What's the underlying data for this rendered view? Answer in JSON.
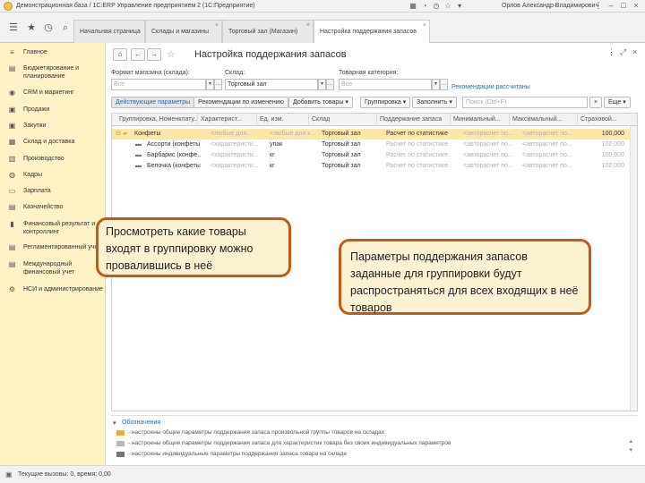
{
  "window": {
    "title": "Демонстрационная база / 1С:ERP Управление предприятием 2  (1С:Предприятие)",
    "user": "Орлов Александр Владимирович"
  },
  "tabs": [
    {
      "label": "Начальная страница"
    },
    {
      "label": "Склады и магазины"
    },
    {
      "label": "Торговый зал (Магазин)"
    },
    {
      "label": "Настройка поддержания запасов"
    }
  ],
  "sidebar": {
    "items": [
      {
        "label": "Главное",
        "icon": "menu-icon"
      },
      {
        "label": "Бюджетирование и планирование",
        "icon": "budget-icon"
      },
      {
        "label": "CRM и маркетинг",
        "icon": "crm-icon"
      },
      {
        "label": "Продажи",
        "icon": "sales-icon"
      },
      {
        "label": "Закупки",
        "icon": "purchases-icon"
      },
      {
        "label": "Склад и доставка",
        "icon": "warehouse-icon"
      },
      {
        "label": "Производство",
        "icon": "production-icon"
      },
      {
        "label": "Кадры",
        "icon": "staff-icon"
      },
      {
        "label": "Зарплата",
        "icon": "salary-icon"
      },
      {
        "label": "Казначейство",
        "icon": "treasury-icon"
      },
      {
        "label": "Финансовый результат и контроллинг",
        "icon": "finance-icon"
      },
      {
        "label": "Регламентированный учет",
        "icon": "accounting-icon"
      },
      {
        "label": "Международный финансовый учет",
        "icon": "intl-finance-icon"
      },
      {
        "label": "НСИ и администрирование",
        "icon": "admin-icon"
      }
    ]
  },
  "form": {
    "title": "Настройка поддержания запасов",
    "filters": {
      "store_format_label": "Формат магазина (склада):",
      "store_format_value": "Все",
      "warehouse_label": "Склад:",
      "warehouse_value": "Торговый зал",
      "category_label": "Товарная категория:",
      "category_value": "Все"
    },
    "recommendations_link": "Рекомендации рассчитаны",
    "toolbar": {
      "active_params": "Действующие параметры",
      "recommend_changes": "Рекомендации по изменению",
      "add_goods": "Добавить товары",
      "grouping": "Группировка",
      "fill": "Заполнить",
      "search_placeholder": "Поиск (Ctrl+F)",
      "more": "Еще"
    }
  },
  "table": {
    "columns": [
      "Группировка, Номенклату...",
      "Характерист...",
      "Ед. изм.",
      "Склад",
      "Поддержание запаса",
      "Минимальный...",
      "Максимальный...",
      "Страховой..."
    ],
    "rows": [
      {
        "name": "Конфеты",
        "char": "<любые для...",
        "unit": "<любые для к...",
        "warehouse": "Торговый зал",
        "method": "Расчет по статистике",
        "min": "<авторасчет по...",
        "max": "<авторасчет по...",
        "safety": "100,000"
      },
      {
        "name": "Ассорти (конфеты)",
        "char": "<характеристи...",
        "unit": "упак",
        "warehouse": "Торговый зал",
        "method": "Расчет по статистике",
        "min": "<авторасчет по...",
        "max": "<авторасчет по...",
        "safety": "100,000"
      },
      {
        "name": "Барбарис (конфе...",
        "char": "<характеристи...",
        "unit": "кг",
        "warehouse": "Торговый зал",
        "method": "Расчет по статистике",
        "min": "<авторасчет по...",
        "max": "<авторасчет по...",
        "safety": "100,000"
      },
      {
        "name": "Белочка (конфеты)",
        "char": "<характеристи...",
        "unit": "кг",
        "warehouse": "Торговый зал",
        "method": "Расчет по статистике",
        "min": "<авторасчет по...",
        "max": "<авторасчет по...",
        "safety": "100,000"
      }
    ]
  },
  "legend": {
    "title": "Обозначения",
    "items": [
      "- настроены общие параметры поддержания запаса произвольной группы товаров на складах",
      "- настроены общие параметры поддержания запаса для характеристик товара без своих индивидуальных параметров",
      "- настроены индивидуальные параметры поддержания запаса товара на складе"
    ]
  },
  "status": {
    "text": "Текущие вызовы: 0, время: 0,00"
  },
  "callouts": {
    "left": "Просмотреть какие товары входят в группировку можно провалившись в неё",
    "right": "Параметры поддержания запасов заданные для группировки будут распространяться для всех входящих в неё товаров"
  },
  "colors": {
    "sidebar": "#fdf3c4",
    "selected_row": "#fae9a6",
    "callout_border": "#c55a11",
    "link": "#2c6bb0"
  }
}
